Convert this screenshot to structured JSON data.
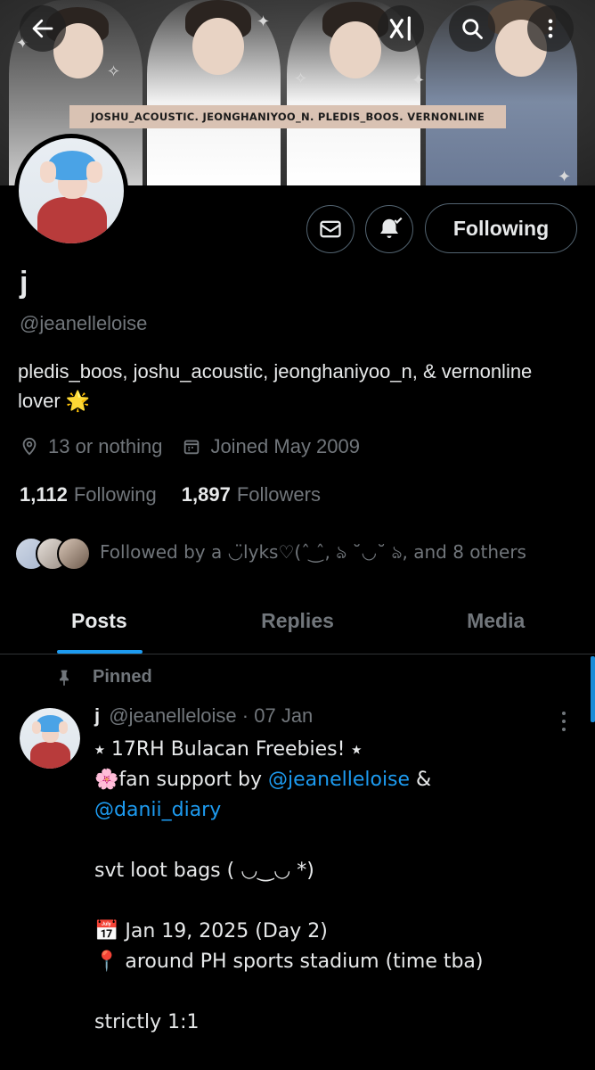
{
  "banner": {
    "caption": "JOSHU_ACOUSTIC. JEONGHANIYOO_N. PLEDIS_BOOS. VERNONLINE"
  },
  "topbar": {
    "back_icon": "arrow-left-icon",
    "grok_icon": "grok-logo-icon",
    "search_icon": "search-icon",
    "more_icon": "more-vertical-icon"
  },
  "profile": {
    "name": "j",
    "handle": "@jeanelleloise",
    "bio": "pledis_boos, joshu_acoustic, jeonghaniyoo_n, & vernonline lover 🌟",
    "location": "13 or nothing",
    "joined": "Joined May 2009",
    "following_count": "1,112",
    "following_label": "Following",
    "followers_count": "1,897",
    "followers_label": "Followers",
    "followed_by": "Followed by a ◡̈lyks♡(ˆ⁠ ͜⁠ˆ, ঌ ˘◡˘ ঌ, and 8 others",
    "follow_button": "Following"
  },
  "tabs": [
    {
      "label": "Posts",
      "active": true
    },
    {
      "label": "Replies",
      "active": false
    },
    {
      "label": "Media",
      "active": false
    }
  ],
  "post": {
    "pinned_label": "Pinned",
    "author_name": "j",
    "author_handle": "@jeanelleloise",
    "date": "· 07 Jan",
    "line1": "⭑ 17RH Bulacan Freebies! ⭑",
    "line2_prefix": "🌸fan support by ",
    "line2_link": "@jeanelleloise",
    "line2_suffix": " &",
    "line3_link": "@danii_diary",
    "line4": "svt loot bags ( ◡‿◡ *)",
    "line5": "📅 Jan 19, 2025 (Day 2)",
    "line6": "📍 around PH sports stadium (time tba)",
    "line7": "strictly 1:1"
  },
  "colors": {
    "background": "#000000",
    "accent": "#1d9bf0",
    "secondary_text": "#71767b",
    "primary_text": "#e7e9ea"
  }
}
